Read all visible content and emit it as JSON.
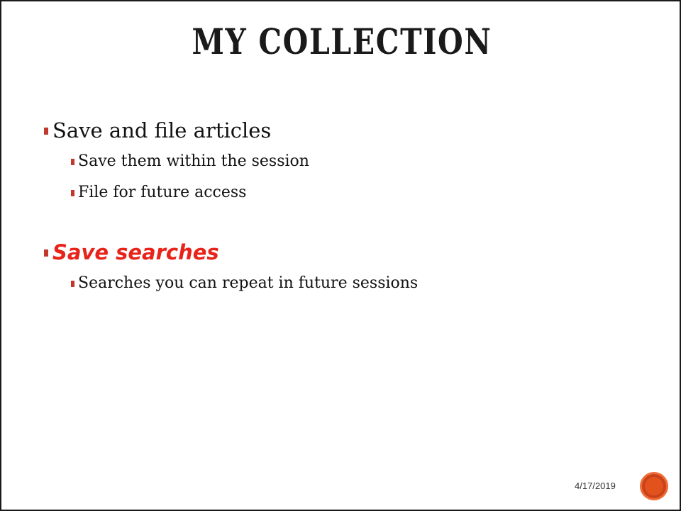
{
  "slide": {
    "title": "MY COLLECTION",
    "bullets": [
      {
        "level": 1,
        "text": "Save and file articles",
        "emphasis": false
      },
      {
        "level": 2,
        "text": "Save them within the session",
        "emphasis": false
      },
      {
        "level": 2,
        "text": "File for future access",
        "emphasis": false
      },
      {
        "level": 1,
        "text": "Save searches",
        "emphasis": true
      },
      {
        "level": 2,
        "text": "Searches you can repeat in future sessions",
        "emphasis": false
      }
    ],
    "footer": {
      "date": "4/17/2019"
    }
  },
  "colors": {
    "accent": "#c0392b",
    "emphasis_text": "#e8231a",
    "logo": "#e2521d"
  }
}
